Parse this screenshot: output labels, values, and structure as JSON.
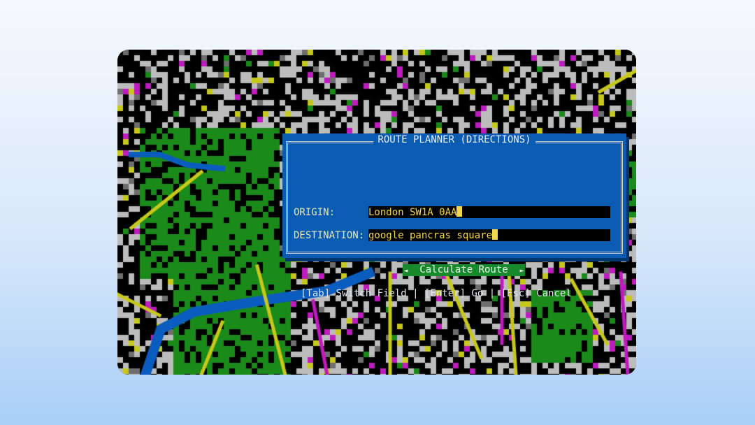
{
  "dialog": {
    "title": "ROUTE PLANNER (DIRECTIONS)",
    "origin_label": "ORIGIN:",
    "origin_value": "London SW1A 0AA",
    "destination_label": "DESTINATION:",
    "destination_value": "google pancras square",
    "calculate_label": "Calculate Route",
    "help_text": "[Tab] Switch Field | [Enter] Go | [Esc] Cancel"
  },
  "map": {
    "colors": {
      "background": "#000000",
      "road": "#bcbcbc",
      "road_dark": "#6e6e6e",
      "park": "#1a8a1a",
      "water": "#0a5cbf",
      "major_road": "#c8c81a",
      "poi": "#c01ac0"
    }
  },
  "colors": {
    "dialog_bg": "#0a5cb3",
    "field_text": "#f2d64b",
    "button_bg": "#178a2b"
  }
}
